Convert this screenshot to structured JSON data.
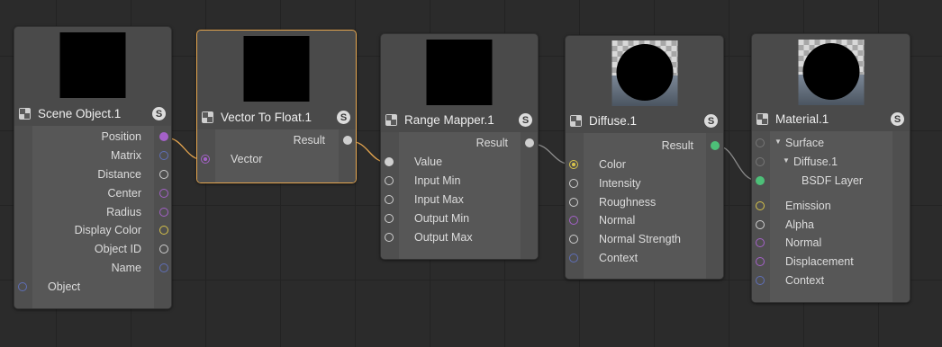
{
  "nodes": {
    "scene_object": {
      "title": "Scene Object.1",
      "badge": "S",
      "outputs": [
        "Position",
        "Matrix",
        "Distance",
        "Center",
        "Radius",
        "Display Color",
        "Object ID",
        "Name"
      ],
      "inputs": [
        "Object"
      ]
    },
    "vector_to_float": {
      "title": "Vector To Float.1",
      "badge": "S",
      "outputs": [
        "Result"
      ],
      "inputs": [
        "Vector"
      ]
    },
    "range_mapper": {
      "title": "Range Mapper.1",
      "badge": "S",
      "outputs": [
        "Result"
      ],
      "inputs": [
        "Value",
        "Input Min",
        "Input Max",
        "Output Min",
        "Output Max"
      ]
    },
    "diffuse": {
      "title": "Diffuse.1",
      "badge": "S",
      "outputs": [
        "Result"
      ],
      "inputs": [
        "Color",
        "Intensity",
        "Roughness",
        "Normal",
        "Normal Strength",
        "Context"
      ]
    },
    "material": {
      "title": "Material.1",
      "badge": "S",
      "tree": [
        "Surface",
        "Diffuse.1",
        "BSDF Layer"
      ],
      "inputs": [
        "Emission",
        "Alpha",
        "Normal",
        "Displacement",
        "Context"
      ]
    }
  },
  "colors": {
    "vector": "#a461c8",
    "matrix": "#5f6fb8",
    "float": "#cfcfcf",
    "color": "#d6c24a",
    "closure": "#4dbf78",
    "selection": "#e6a64f",
    "wire": "#8c8c8c"
  }
}
